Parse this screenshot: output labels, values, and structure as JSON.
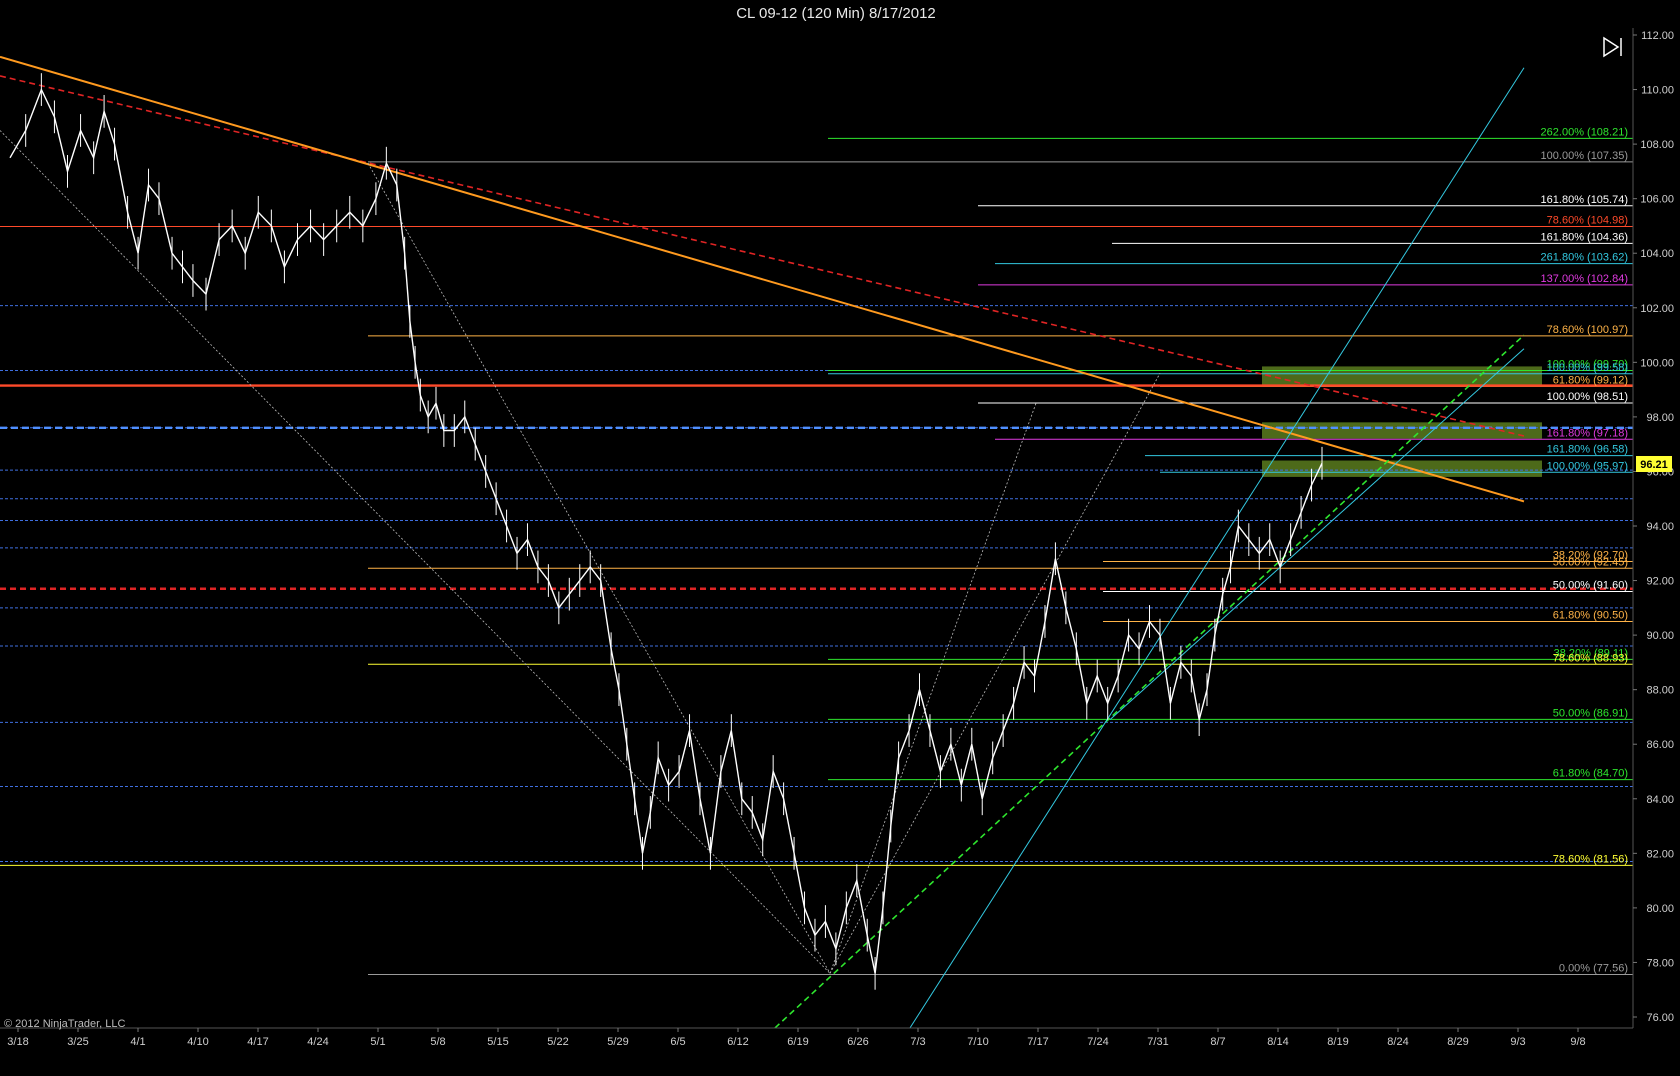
{
  "title": "CL 09-12 (120 Min)  8/17/2012",
  "copyright": "© 2012 NinjaTrader, LLC",
  "current_price_label": "96.21",
  "colors": {
    "background": "#000000",
    "price": "#ffffff",
    "orange": "#ff9a1f",
    "red": "#e02424",
    "blue": "#3f6fe0",
    "green": "#2ee62e",
    "cyan": "#33c8e0",
    "yellow_tag": "#ffff33"
  },
  "chart_data": {
    "type": "line",
    "ylim": [
      75,
      112
    ],
    "x_ticks": [
      "3/18",
      "3/25",
      "4/1",
      "4/10",
      "4/17",
      "4/24",
      "5/1",
      "5/8",
      "5/15",
      "5/22",
      "5/29",
      "6/5",
      "6/12",
      "6/19",
      "6/26",
      "7/3",
      "7/10",
      "7/17",
      "7/24",
      "7/31",
      "8/7",
      "8/14",
      "8/19",
      "8/24",
      "8/29",
      "9/3",
      "9/8"
    ],
    "y_ticks": [
      "76.00",
      "78.00",
      "80.00",
      "82.00",
      "84.00",
      "86.00",
      "88.00",
      "90.00",
      "92.00",
      "94.00",
      "96.00",
      "98.00",
      "100.00",
      "102.00",
      "104.00",
      "106.00",
      "108.00",
      "110.00",
      "112.00"
    ],
    "price_series": [
      [
        0,
        107.5
      ],
      [
        6,
        108.5
      ],
      [
        12,
        110.0
      ],
      [
        17,
        109.0
      ],
      [
        22,
        107.0
      ],
      [
        27,
        108.5
      ],
      [
        32,
        107.5
      ],
      [
        36,
        109.2
      ],
      [
        40,
        108.0
      ],
      [
        45,
        105.5
      ],
      [
        49,
        104.0
      ],
      [
        53,
        106.5
      ],
      [
        57,
        106.0
      ],
      [
        62,
        104.0
      ],
      [
        66,
        103.5
      ],
      [
        70,
        103.0
      ],
      [
        75,
        102.5
      ],
      [
        80,
        104.5
      ],
      [
        85,
        105.0
      ],
      [
        90,
        104.0
      ],
      [
        95,
        105.5
      ],
      [
        100,
        105.0
      ],
      [
        105,
        103.5
      ],
      [
        110,
        104.5
      ],
      [
        115,
        105.0
      ],
      [
        120,
        104.5
      ],
      [
        125,
        105.0
      ],
      [
        130,
        105.5
      ],
      [
        135,
        105.0
      ],
      [
        140,
        106.0
      ],
      [
        144,
        107.3
      ],
      [
        148,
        106.5
      ],
      [
        151,
        104.0
      ],
      [
        153,
        101.5
      ],
      [
        155,
        100.0
      ],
      [
        157,
        98.8
      ],
      [
        160,
        98.0
      ],
      [
        163,
        98.5
      ],
      [
        166,
        97.5
      ],
      [
        170,
        97.5
      ],
      [
        174,
        98.0
      ],
      [
        178,
        97.0
      ],
      [
        182,
        96.0
      ],
      [
        186,
        95.0
      ],
      [
        190,
        94.0
      ],
      [
        194,
        93.0
      ],
      [
        198,
        93.5
      ],
      [
        202,
        92.5
      ],
      [
        206,
        92.0
      ],
      [
        210,
        91.0
      ],
      [
        214,
        91.5
      ],
      [
        218,
        92.0
      ],
      [
        222,
        92.5
      ],
      [
        226,
        92.0
      ],
      [
        230,
        89.5
      ],
      [
        233,
        88.0
      ],
      [
        236,
        86.0
      ],
      [
        239,
        84.0
      ],
      [
        242,
        82.0
      ],
      [
        245,
        83.5
      ],
      [
        248,
        85.5
      ],
      [
        252,
        84.5
      ],
      [
        256,
        85.0
      ],
      [
        260,
        86.5
      ],
      [
        264,
        84.0
      ],
      [
        268,
        82.0
      ],
      [
        272,
        85.0
      ],
      [
        276,
        86.5
      ],
      [
        280,
        84.0
      ],
      [
        284,
        83.5
      ],
      [
        288,
        82.5
      ],
      [
        292,
        85.0
      ],
      [
        296,
        84.0
      ],
      [
        300,
        82.0
      ],
      [
        304,
        80.0
      ],
      [
        308,
        79.0
      ],
      [
        312,
        79.5
      ],
      [
        316,
        78.5
      ],
      [
        320,
        80.0
      ],
      [
        324,
        81.0
      ],
      [
        328,
        79.0
      ],
      [
        331,
        77.6
      ],
      [
        334,
        80.0
      ],
      [
        337,
        83.0
      ],
      [
        340,
        85.5
      ],
      [
        344,
        86.5
      ],
      [
        348,
        88.0
      ],
      [
        352,
        86.5
      ],
      [
        356,
        85.0
      ],
      [
        360,
        86.0
      ],
      [
        364,
        84.5
      ],
      [
        368,
        86.0
      ],
      [
        372,
        84.0
      ],
      [
        376,
        85.5
      ],
      [
        380,
        86.5
      ],
      [
        384,
        87.5
      ],
      [
        388,
        89.0
      ],
      [
        392,
        88.5
      ],
      [
        396,
        90.5
      ],
      [
        400,
        92.8
      ],
      [
        404,
        91.0
      ],
      [
        408,
        89.5
      ],
      [
        412,
        87.5
      ],
      [
        416,
        88.5
      ],
      [
        420,
        87.5
      ],
      [
        424,
        88.5
      ],
      [
        428,
        90.0
      ],
      [
        432,
        89.5
      ],
      [
        436,
        90.5
      ],
      [
        440,
        90.0
      ],
      [
        444,
        87.5
      ],
      [
        448,
        89.0
      ],
      [
        452,
        88.5
      ],
      [
        455,
        86.9
      ],
      [
        458,
        88.0
      ],
      [
        461,
        90.0
      ],
      [
        464,
        91.5
      ],
      [
        467,
        92.5
      ],
      [
        470,
        94.0
      ],
      [
        474,
        93.5
      ],
      [
        478,
        93.0
      ],
      [
        482,
        93.5
      ],
      [
        486,
        92.5
      ],
      [
        490,
        93.5
      ],
      [
        494,
        94.5
      ],
      [
        498,
        95.5
      ],
      [
        502,
        96.3
      ]
    ],
    "horizontal_levels": [
      {
        "price": 108.21,
        "color": "#2ee62e",
        "x_from": 828,
        "label": "262.00% (108.21)"
      },
      {
        "price": 107.35,
        "color": "#9a9a9a",
        "x_from": 368,
        "label": "100.00% (107.35)"
      },
      {
        "price": 105.74,
        "color": "#ffffff",
        "x_from": 978,
        "label": "161.80% (105.74)"
      },
      {
        "price": 104.98,
        "color": "#ff4a2a",
        "x_from": 0,
        "label": "78.60% (104.98)"
      },
      {
        "price": 104.36,
        "color": "#ffffff",
        "x_from": 1112,
        "label": "161.80% (104.36)"
      },
      {
        "price": 103.62,
        "color": "#33c8e0",
        "x_from": 995,
        "label": "261.80% (103.62)"
      },
      {
        "price": 102.84,
        "color": "#e03ae0",
        "x_from": 978,
        "label": "137.00% (102.84)"
      },
      {
        "price": 100.97,
        "color": "#ffb347",
        "x_from": 368,
        "label": "78.60% (100.97)"
      },
      {
        "price": 99.7,
        "color": "#2ee62e",
        "x_from": 828,
        "label": "100.00% (99.70)"
      },
      {
        "price": 99.58,
        "color": "#33c8e0",
        "x_from": 828,
        "label": "100.00% (99.58)"
      },
      {
        "price": 99.12,
        "color": "#ffb347",
        "x_from": 1160,
        "label": "61.80% (99.12)"
      },
      {
        "price": 98.51,
        "color": "#ffffff",
        "x_from": 978,
        "label": "100.00% (98.51)"
      },
      {
        "price": 97.18,
        "color": "#e03ae0",
        "x_from": 995,
        "label": "161.80% (97.18)"
      },
      {
        "price": 96.58,
        "color": "#33c8e0",
        "x_from": 1145,
        "label": "161.80% (96.58)"
      },
      {
        "price": 95.97,
        "color": "#33c8e0",
        "x_from": 1160,
        "label": "100.00% (95.97)"
      },
      {
        "price": 92.7,
        "color": "#ffb347",
        "x_from": 1103,
        "label": "38.20% (92.70)"
      },
      {
        "price": 92.45,
        "color": "#ffb347",
        "x_from": 368,
        "label": "50.00% (92.45)"
      },
      {
        "price": 91.6,
        "color": "#ffffff",
        "x_from": 1103,
        "label": "50.00% (91.60)"
      },
      {
        "price": 90.5,
        "color": "#ffb347",
        "x_from": 1103,
        "label": "61.80% (90.50)"
      },
      {
        "price": 89.11,
        "color": "#2ee62e",
        "x_from": 828,
        "label": "38.20% (89.11)"
      },
      {
        "price": 88.93,
        "color": "#ffff33",
        "x_from": 368,
        "label": "78.60% (88.93)"
      },
      {
        "price": 86.91,
        "color": "#2ee62e",
        "x_from": 828,
        "label": "50.00% (86.91)"
      },
      {
        "price": 84.7,
        "color": "#2ee62e",
        "x_from": 828,
        "label": "61.80% (84.70)"
      },
      {
        "price": 81.56,
        "color": "#ffff33",
        "x_from": 0,
        "label": "78.60% (81.56)"
      },
      {
        "price": 77.56,
        "color": "#9a9a9a",
        "x_from": 368,
        "label": "0.00% (77.56)"
      }
    ],
    "blue_dashed_levels": [
      102.08,
      99.7,
      97.6,
      96.05,
      95.0,
      94.2,
      93.2,
      91.0,
      89.6,
      86.8,
      84.45,
      81.7
    ],
    "thick_lines": [
      {
        "price": 99.15,
        "color": "#ff4a2a"
      },
      {
        "price": 97.6,
        "color": "#4f8fff"
      },
      {
        "price": 91.7,
        "color": "#e02424"
      }
    ],
    "zones": [
      {
        "from": 99.15,
        "to": 99.85,
        "color": "#5a7d1e"
      },
      {
        "from": 97.2,
        "to": 97.8,
        "color": "#5a7d1e"
      },
      {
        "from": 95.8,
        "to": 96.4,
        "color": "#5a7d1e"
      }
    ],
    "trendlines": [
      {
        "x1": 0,
        "y1": 110.5,
        "x2": 1524,
        "y2": 97.3,
        "color": "#e02424",
        "dash": "6,4",
        "width": 1.6
      },
      {
        "x1": 0,
        "y1": 111.2,
        "x2": 1524,
        "y2": 94.9,
        "color": "#ff9a1f",
        "dash": "",
        "width": 2
      },
      {
        "x1": 775,
        "y1": 75.6,
        "x2": 1524,
        "y2": 101.0,
        "color": "#2ee62e",
        "dash": "6,4",
        "width": 1.6
      },
      {
        "x1": 910,
        "y1": 75.6,
        "x2": 1524,
        "y2": 110.8,
        "color": "#33c8e0",
        "dash": "",
        "width": 1
      },
      {
        "x1": 1110,
        "y1": 86.9,
        "x2": 1524,
        "y2": 100.5,
        "color": "#33c8e0",
        "dash": "",
        "width": 1
      },
      {
        "x1": 0,
        "y1": 108.5,
        "x2": 830,
        "y2": 77.6,
        "color": "#bbbbbb",
        "dash": "2,2",
        "width": 0.8
      },
      {
        "x1": 368,
        "y1": 107.3,
        "x2": 830,
        "y2": 77.6,
        "color": "#bbbbbb",
        "dash": "2,2",
        "width": 0.8
      },
      {
        "x1": 830,
        "y1": 77.6,
        "x2": 1036,
        "y2": 98.5,
        "color": "#bbbbbb",
        "dash": "2,2",
        "width": 0.8
      },
      {
        "x1": 830,
        "y1": 77.6,
        "x2": 1160,
        "y2": 99.6,
        "color": "#bbbbbb",
        "dash": "2,2",
        "width": 0.8
      }
    ]
  }
}
